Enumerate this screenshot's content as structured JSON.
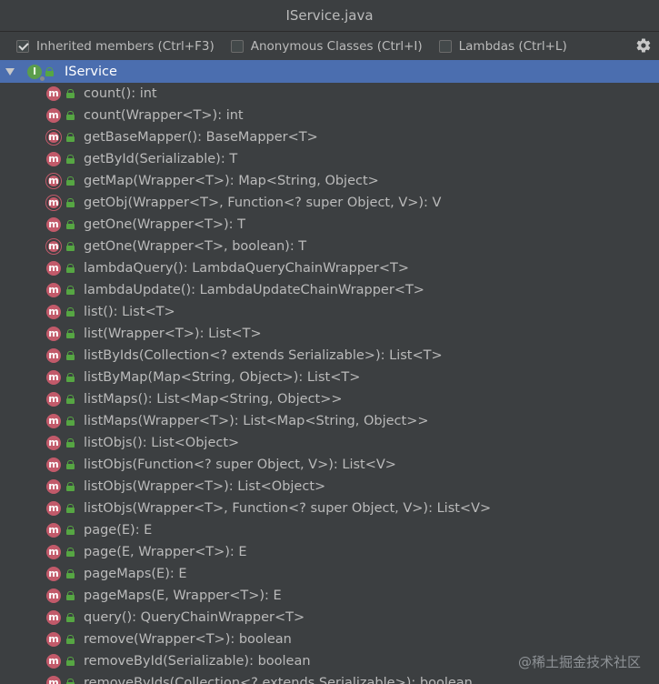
{
  "window": {
    "title": "IService.java"
  },
  "toolbar": {
    "inherited": {
      "label": "Inherited members (Ctrl+F3)",
      "checked": true
    },
    "anonymous": {
      "label": "Anonymous Classes (Ctrl+I)",
      "checked": false
    },
    "lambdas": {
      "label": "Lambdas (Ctrl+L)",
      "checked": false
    }
  },
  "tree": {
    "root": {
      "icon": "interface-icon",
      "icon_letter": "I",
      "label": "IService"
    },
    "members": [
      {
        "label": "count(): int",
        "abstract": false
      },
      {
        "label": "count(Wrapper<T>): int",
        "abstract": false
      },
      {
        "label": "getBaseMapper(): BaseMapper<T>",
        "abstract": true
      },
      {
        "label": "getById(Serializable): T",
        "abstract": false
      },
      {
        "label": "getMap(Wrapper<T>): Map<String, Object>",
        "abstract": true
      },
      {
        "label": "getObj(Wrapper<T>, Function<? super Object, V>): V",
        "abstract": true
      },
      {
        "label": "getOne(Wrapper<T>): T",
        "abstract": false
      },
      {
        "label": "getOne(Wrapper<T>, boolean): T",
        "abstract": true
      },
      {
        "label": "lambdaQuery(): LambdaQueryChainWrapper<T>",
        "abstract": false
      },
      {
        "label": "lambdaUpdate(): LambdaUpdateChainWrapper<T>",
        "abstract": false
      },
      {
        "label": "list(): List<T>",
        "abstract": false
      },
      {
        "label": "list(Wrapper<T>): List<T>",
        "abstract": false
      },
      {
        "label": "listByIds(Collection<? extends Serializable>): List<T>",
        "abstract": false
      },
      {
        "label": "listByMap(Map<String, Object>): List<T>",
        "abstract": false
      },
      {
        "label": "listMaps(): List<Map<String, Object>>",
        "abstract": false
      },
      {
        "label": "listMaps(Wrapper<T>): List<Map<String, Object>>",
        "abstract": false
      },
      {
        "label": "listObjs(): List<Object>",
        "abstract": false
      },
      {
        "label": "listObjs(Function<? super Object, V>): List<V>",
        "abstract": false
      },
      {
        "label": "listObjs(Wrapper<T>): List<Object>",
        "abstract": false
      },
      {
        "label": "listObjs(Wrapper<T>, Function<? super Object, V>): List<V>",
        "abstract": false
      },
      {
        "label": "page(E): E",
        "abstract": false
      },
      {
        "label": "page(E, Wrapper<T>): E",
        "abstract": false
      },
      {
        "label": "pageMaps(E): E",
        "abstract": false
      },
      {
        "label": "pageMaps(E, Wrapper<T>): E",
        "abstract": false
      },
      {
        "label": "query(): QueryChainWrapper<T>",
        "abstract": false
      },
      {
        "label": "remove(Wrapper<T>): boolean",
        "abstract": false
      },
      {
        "label": "removeById(Serializable): boolean",
        "abstract": false
      },
      {
        "label": "removeByIds(Collection<? extends Serializable>): boolean",
        "abstract": false
      }
    ],
    "member_icon_letter": "m"
  },
  "watermark": "@稀土掘金技术社区",
  "colors": {
    "background": "#3c3f41",
    "selection": "#4b6eaf",
    "method_icon": "#c25a6a",
    "interface_icon": "#5b9d4c",
    "public_lock": "#56a643"
  }
}
